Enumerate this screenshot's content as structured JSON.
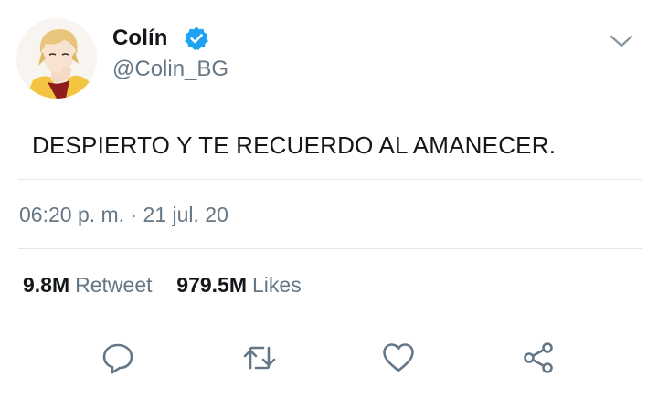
{
  "tweet": {
    "author_name": "Colín",
    "handle": "@Colin_BG",
    "text": "DESPIERTO Y TE RECUERDO AL AMANECER.",
    "time": "06:20 p. m.",
    "separator": "·",
    "date": "21 jul. 20",
    "retweets_count": "9.8M",
    "retweets_label": "Retweet",
    "likes_count": "979.5M",
    "likes_label": "Likes"
  },
  "icons": {
    "verified": "verified-badge-icon",
    "more": "chevron-down-icon",
    "reply": "reply-icon",
    "retweet": "retweet-icon",
    "like": "heart-icon",
    "share": "share-icon"
  },
  "colors": {
    "text": "#14171a",
    "secondary": "#657786",
    "verified": "#1da1f2",
    "divider": "#e1e8ed"
  }
}
